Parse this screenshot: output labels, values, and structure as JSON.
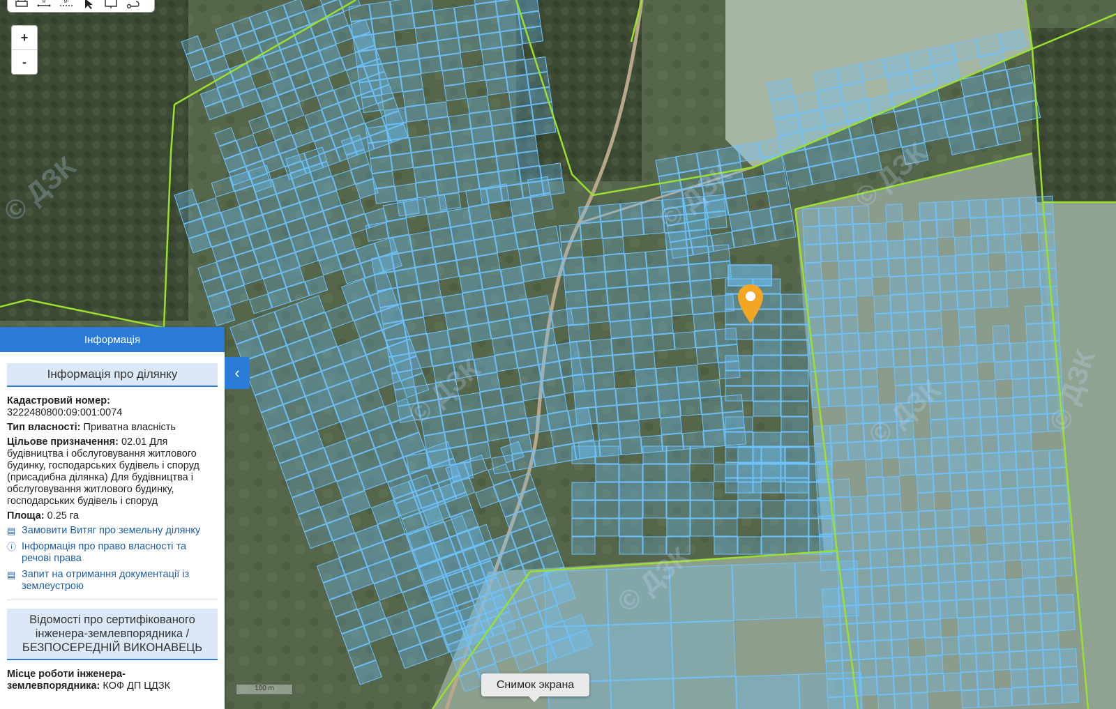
{
  "toolbar": {
    "tools": [
      "print-icon",
      "measure-length-icon",
      "measure-area-icon",
      "pointer-icon",
      "screen-icon",
      "route-icon"
    ]
  },
  "zoom": {
    "in_label": "+",
    "out_label": "-"
  },
  "map": {
    "watermark": "© ДЗК",
    "scale_label": "100 m",
    "screenshot_tooltip": "Снимок экрана",
    "colors": {
      "parcel": "#6ec3ff",
      "boundary": "#9be030",
      "marker": "#f2a623"
    }
  },
  "panel": {
    "header": "Інформація",
    "section1_title": "Інформація про ділянку",
    "cadastral_label": "Кадастровий номер:",
    "cadastral_value": "3222480800:09:001:0074",
    "ownership_label": "Тип власності:",
    "ownership_value": "Приватна власність",
    "purpose_label": "Цільове призначення:",
    "purpose_value": "02.01 Для будівництва і обслуговування житлового будинку, господарських будівель і споруд (присадибна ділянка) Для будівництва і обслуговування житлового будинку, господарських будівель і споруд",
    "area_label": "Площа:",
    "area_value": "0.25 га",
    "link1": "Замовити Витяг про земельну ділянку",
    "link2": "Інформація про право власності та речові права",
    "link3": "Запит на отримання документації із землеустрою",
    "section2_title": "Відомості про сертифікованого інженера-землевпорядника / БЕЗПОСЕРЕДНІЙ ВИКОНАВЕЦЬ",
    "workplace_label": "Місце роботи інженера-землевпорядника:",
    "workplace_value": "КОФ ДП ЦДЗК"
  }
}
